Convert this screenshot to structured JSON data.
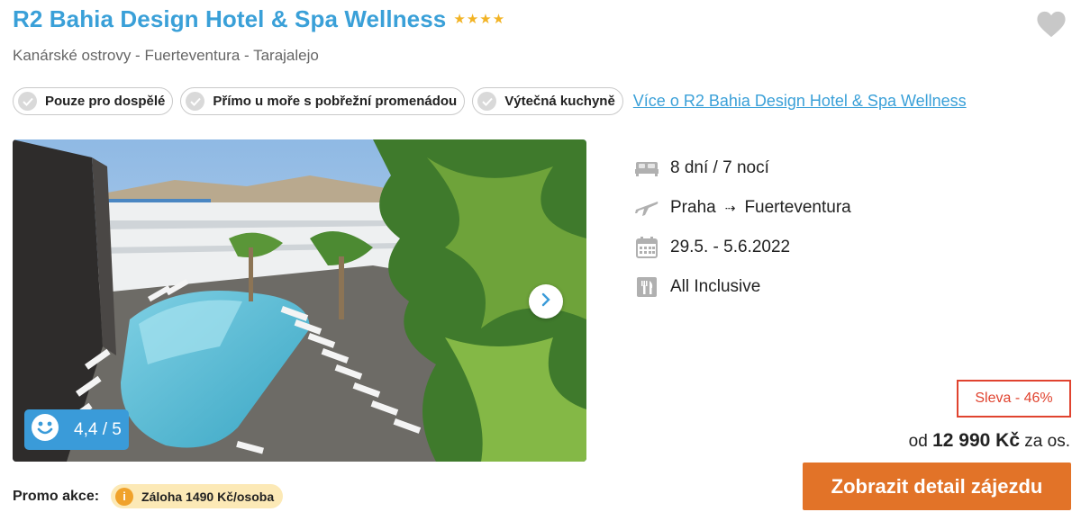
{
  "hotel": {
    "name": "R2 Bahia Design Hotel & Spa Wellness",
    "stars": 4,
    "location": "Kanárské ostrovy - Fuerteventura - Tarajalejo"
  },
  "tags": [
    {
      "label": "Pouze pro dospělé"
    },
    {
      "label": "Přímo u moře s pobřežní promenádou"
    },
    {
      "label": "Výtečná kuchyně"
    }
  ],
  "more_link": "Více o R2 Bahia Design Hotel & Spa Wellness",
  "rating": {
    "value": "4,4 / 5"
  },
  "trip": {
    "duration": "8 dní / 7 nocí",
    "from": "Praha",
    "arrow": "⇢",
    "to": "Fuerteventura",
    "dates": "29.5. - 5.6.2022",
    "board": "All Inclusive"
  },
  "price": {
    "discount": "Sleva - 46%",
    "prefix": "od",
    "amount": "12 990 Kč",
    "suffix": "za os."
  },
  "detail_button": "Zobrazit detail zájezdu",
  "promo": {
    "label": "Promo akce:",
    "badge": "Záloha 1490 Kč/osoba"
  },
  "colors": {
    "accent_blue": "#3aa0d8",
    "star": "#f2b324",
    "discount_red": "#e0432f",
    "button_orange": "#e27328",
    "promo_yellow": "#fce9b6"
  },
  "icons": {
    "favorite": "heart-icon",
    "tag": "check-icon",
    "next": "chevron-right-icon",
    "rating": "smiley-icon",
    "duration": "bed-icon",
    "flight": "plane-icon",
    "dates": "calendar-icon",
    "board": "cutlery-icon",
    "promo": "info-icon"
  }
}
